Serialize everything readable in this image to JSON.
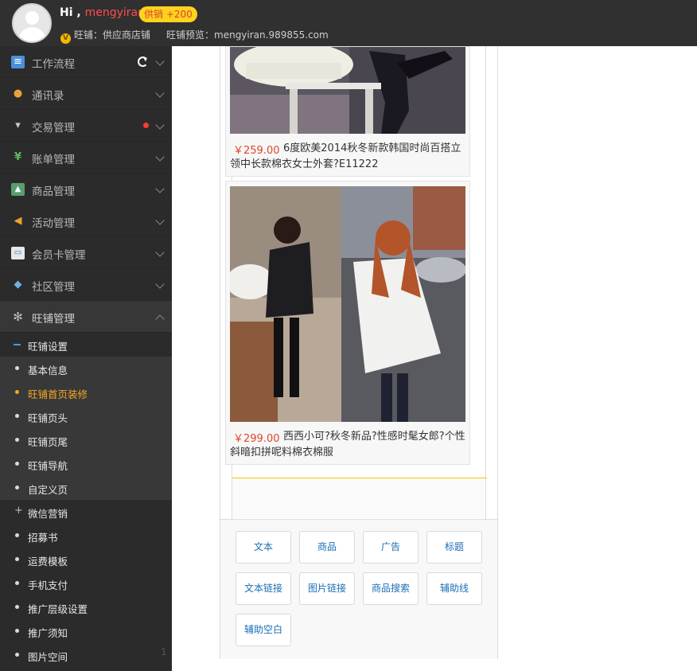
{
  "header": {
    "greeting": "Hi ,",
    "username": "mengyiran",
    "badge": "供销 +200",
    "shop_label": "旺铺：供应商店铺",
    "preview_label": "旺铺预览：mengyiran.989855.com"
  },
  "sidebar": {
    "items": [
      {
        "label": "工作流程",
        "icon": "workflow-icon"
      },
      {
        "label": "通讯录",
        "icon": "contacts-icon"
      },
      {
        "label": "交易管理",
        "icon": "basket-icon"
      },
      {
        "label": "账单管理",
        "icon": "yen-icon"
      },
      {
        "label": "商品管理",
        "icon": "picture-icon"
      },
      {
        "label": "活动管理",
        "icon": "megaphone-icon"
      },
      {
        "label": "会员卡管理",
        "icon": "card-icon"
      },
      {
        "label": "社区管理",
        "icon": "chat-icon"
      },
      {
        "label": "旺铺管理",
        "icon": "gear-icon"
      }
    ],
    "sub_items": [
      "旺铺设置",
      "基本信息",
      "旺铺首页装修",
      "旺铺页头",
      "旺铺页尾",
      "旺铺导航",
      "自定义页",
      "微信营销",
      "招募书",
      "运费模板",
      "手机支付",
      "推广层级设置",
      "推广须知",
      "图片空间"
    ],
    "page_number": "1"
  },
  "products": [
    {
      "price": "￥259.00",
      "title": "6度欧美2014秋冬新款韩国时尚百搭立领中长款棉衣女士外套?E11222"
    },
    {
      "price": "￥299.00",
      "title": "西西小可?秋冬新品?性感时髦女郎?个性斜暗扣拼呢料棉衣棉服"
    }
  ],
  "toolbox": {
    "buttons": [
      "文本",
      "商品",
      "广告",
      "标题",
      "文本链接",
      "图片链接",
      "商品搜索",
      "辅助线",
      "辅助空白"
    ]
  },
  "colors": {
    "topbar": "#303030",
    "sidebar": "#2b2b2b",
    "active": "#f5a623",
    "price": "#e0442b",
    "link": "#1a6fb5",
    "badge": "#ffd21f"
  }
}
